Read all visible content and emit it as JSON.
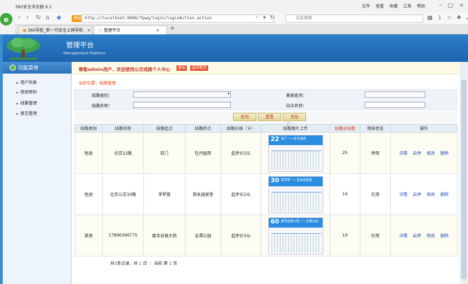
{
  "browser": {
    "app_title": "360安全浏览器 9.1",
    "menu": [
      "文件",
      "查看",
      "收藏",
      "工具",
      "帮助"
    ],
    "compat_badge": "网站重定向",
    "url": "http://localhost:9088/fpwq/login/loginAction.action",
    "search_placeholder": "点此搜索",
    "tabs": [
      {
        "label": "360导航_新一代安全上网导航"
      },
      {
        "label": "管理平台"
      }
    ],
    "new_tab": "+"
  },
  "header": {
    "title": "管理平台",
    "subtitle": "Management Platform"
  },
  "sidebar": {
    "heading": "功能菜单",
    "items": [
      {
        "label": "用户列表"
      },
      {
        "label": "修改密码"
      },
      {
        "label": "线路管理"
      },
      {
        "label": "留言管理"
      }
    ]
  },
  "welcome": {
    "text": "尊敬admin用户，欢迎使用公交线路个人中心",
    "logout": "退出",
    "home": "返回首页"
  },
  "breadcrumb": "当前位置：线路管理",
  "search": {
    "type_label": "线路类别：",
    "query_label": "换乘查询：",
    "name_label": "线路名称：",
    "station_label": "站点名称："
  },
  "buttons": {
    "query": "查询",
    "reset": "重置",
    "add": "添加"
  },
  "table": {
    "columns": [
      "线路类别",
      "线路名称",
      "线路起点",
      "线路终点",
      "线路价格（￥）",
      "线路图片上传",
      "线路总站数",
      "审核状态",
      "操作"
    ],
    "rows": [
      {
        "type": "短途",
        "name": "北京22路",
        "start": "前门",
        "end": "牡丹园西",
        "price": "起步价2元",
        "route_num": "22",
        "route_title": "前门 ⟶ 牡丹园西",
        "stations": "25",
        "status": "停用",
        "ops": [
          "详情",
          "启停",
          "修改",
          "删除"
        ]
      },
      {
        "type": "短途",
        "name": "北京公交30路",
        "start": "李罗营",
        "end": "首永园景里",
        "price": "起步价2元",
        "route_num": "30",
        "route_title": "李罗营 ⟶ 首永园景里",
        "stations": "16",
        "status": "在用",
        "ops": [
          "详情",
          "启停",
          "修改",
          "删除"
        ]
      },
      {
        "type": "其他",
        "name": "17896396775",
        "start": "黄寺总政大院",
        "end": "龙潭公园",
        "price": "起步价3元",
        "route_num": "60",
        "route_title": "黄寺总政大院 ⟶ 龙潭公园",
        "stations": "19",
        "status": "在用",
        "ops": [
          "详情",
          "启停",
          "修改",
          "删除"
        ]
      }
    ]
  },
  "pagination": {
    "prefix": "共",
    "records": "3",
    "mid1": "条记录，共",
    "pages": "1",
    "mid2": "页 ｜ 当前 第",
    "current": "1",
    "suffix": "页"
  }
}
